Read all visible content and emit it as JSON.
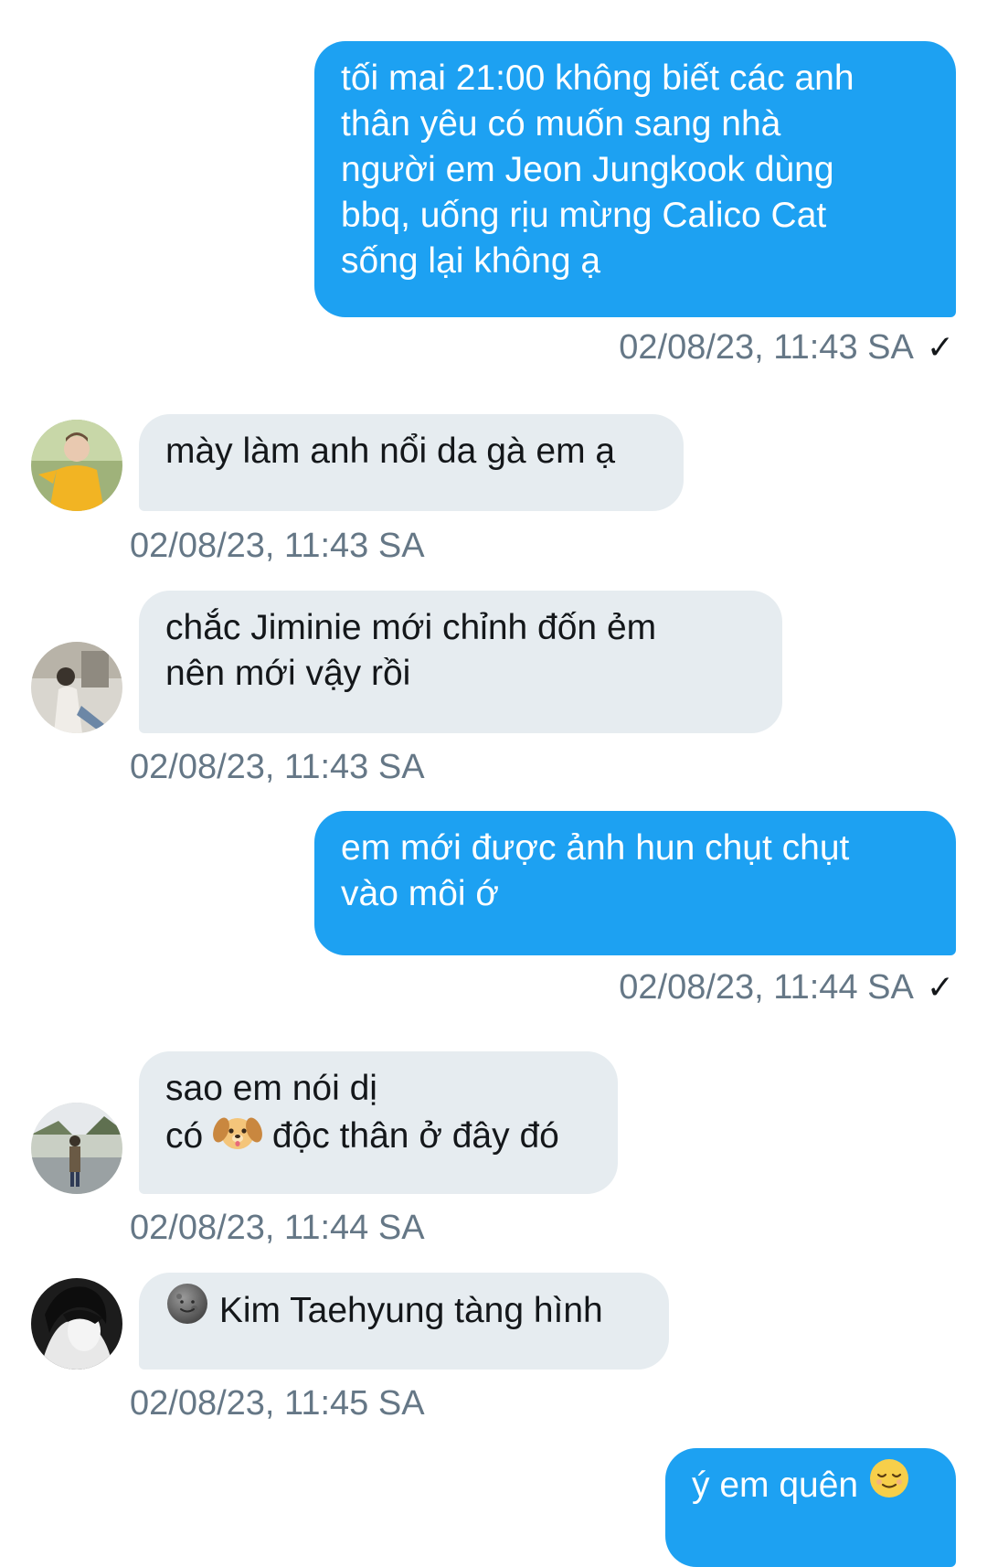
{
  "messages": [
    {
      "direction": "outgoing",
      "text": "tối mai 21:00 không biết các anh\nthân yêu có muốn sang nhà\nngười em Jeon Jungkook dùng\nbbq, uống rịu mừng Calico Cat\nsống lại không ạ",
      "timestamp": "02/08/23, 11:43 SA",
      "status_icon": "check-icon"
    },
    {
      "direction": "incoming",
      "text": "mày làm anh nổi da gà em ạ",
      "timestamp": "02/08/23, 11:43 SA",
      "avatar": "avatar-yellow-shirt"
    },
    {
      "direction": "incoming",
      "text": "chắc Jiminie mới chỉnh đốn ẻm\nnên mới vậy rồi",
      "timestamp": "02/08/23, 11:43 SA",
      "avatar": "avatar-room"
    },
    {
      "direction": "outgoing",
      "text": "em mới được ảnh hun chụt chụt\nvào môi ớ",
      "timestamp": "02/08/23, 11:44 SA",
      "status_icon": "check-icon"
    },
    {
      "direction": "incoming",
      "text_line1": "sao em nói dị",
      "text_line2_pre": "có ",
      "text_line2_emoji": "dog-face-emoji",
      "text_line2_post": " độc thân ở đây đó",
      "timestamp": "02/08/23, 11:44 SA",
      "avatar": "avatar-street"
    },
    {
      "direction": "incoming",
      "text_emoji": "new-moon-face-emoji",
      "text": " Kim Taehyung tàng hình",
      "timestamp": "02/08/23, 11:45 SA",
      "avatar": "avatar-bw"
    },
    {
      "direction": "outgoing",
      "text": "ý em quên ",
      "text_emoji": "relieved-face-emoji"
    }
  ],
  "colors": {
    "outgoing_bubble": "#1DA1F2",
    "incoming_bubble": "#E6ECF0",
    "timestamp": "#657786",
    "incoming_text": "#14171A"
  }
}
